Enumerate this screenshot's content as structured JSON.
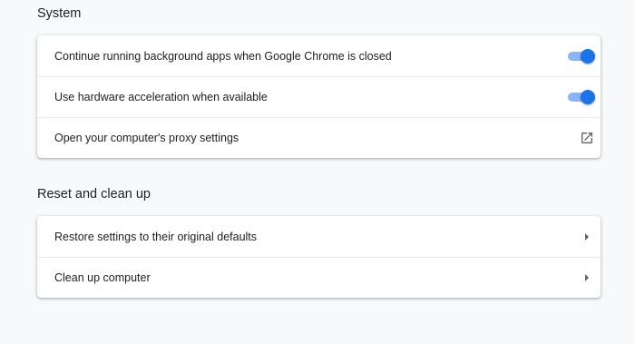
{
  "sections": {
    "system": {
      "title": "System",
      "rows": [
        {
          "label": "Continue running background apps when Google Chrome is closed",
          "control": "toggle",
          "state": "on"
        },
        {
          "label": "Use hardware acceleration when available",
          "control": "toggle",
          "state": "on"
        },
        {
          "label": "Open your computer's proxy settings",
          "control": "external-link-icon"
        }
      ]
    },
    "reset": {
      "title": "Reset and clean up",
      "rows": [
        {
          "label": "Restore settings to their original defaults",
          "control": "arrow-right-icon"
        },
        {
          "label": "Clean up computer",
          "control": "arrow-right-icon"
        }
      ]
    }
  },
  "colors": {
    "accent": "#1a73e8",
    "toggle_track": "#8ab4f8",
    "background": "#f8f9fa",
    "icon": "#5f6368"
  }
}
